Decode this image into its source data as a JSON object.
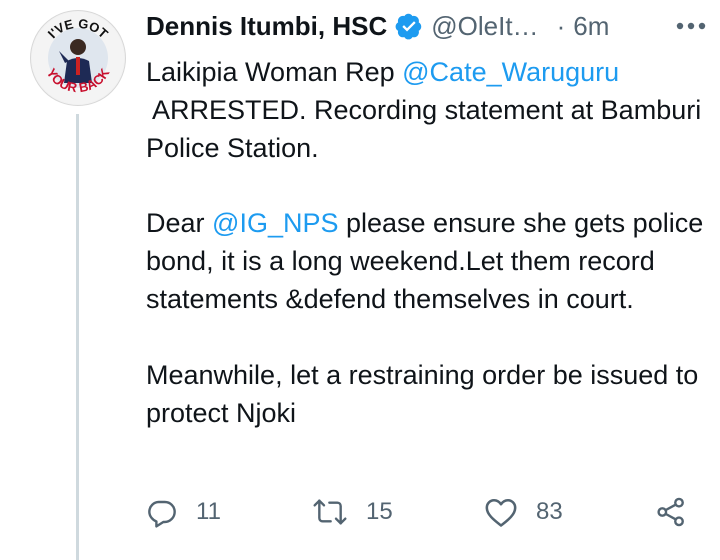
{
  "author": {
    "name": "Dennis Itumbi, HSC",
    "handle": "@OleIt…",
    "separator": "·",
    "time": "6m",
    "avatar_text_top": "I'VE GOT",
    "avatar_text_bottom": "YOUR BACK"
  },
  "tweet": {
    "line1_prefix": "Laikipia Woman Rep ",
    "mention1": "@Cate_Waruguru",
    "line1_rest": "ARRESTED. Recording statement at Bamburi Police Station.",
    "para2_prefix": "Dear ",
    "mention2": "@IG_NPS",
    "para2_rest": " please ensure she gets police bond, it is a long weekend.Let them record statements &defend themselves in court.",
    "para3": "Meanwhile, let a restraining order be issued to protect Njoki"
  },
  "actions": {
    "replies": "11",
    "retweets": "15",
    "likes": "83"
  },
  "colors": {
    "accent": "#1d9bf0",
    "muted": "#536471",
    "text": "#0f1419"
  },
  "icons": [
    "verified-badge-icon",
    "more-icon",
    "reply-icon",
    "retweet-icon",
    "like-icon",
    "share-icon"
  ]
}
